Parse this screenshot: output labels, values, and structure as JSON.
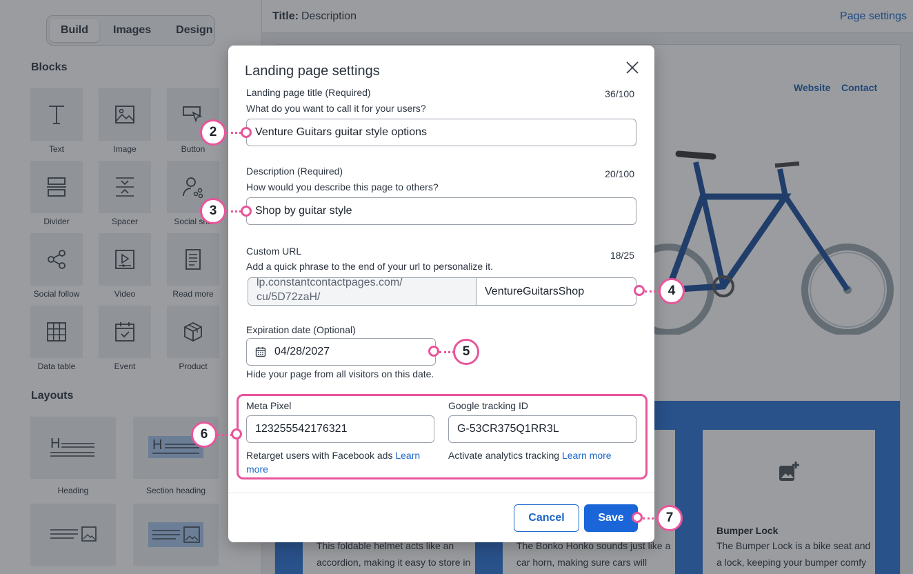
{
  "builder": {
    "tabs": [
      "Build",
      "Images",
      "Design"
    ],
    "active_tab": "Build",
    "blocks_title": "Blocks",
    "blocks": [
      {
        "label": "Text",
        "icon": "text-icon"
      },
      {
        "label": "Image",
        "icon": "image-icon"
      },
      {
        "label": "Button",
        "icon": "button-icon"
      },
      {
        "label": "Divider",
        "icon": "divider-icon"
      },
      {
        "label": "Spacer",
        "icon": "spacer-icon"
      },
      {
        "label": "Social sha",
        "icon": "social-share-icon"
      },
      {
        "label": "Social follow",
        "icon": "social-follow-icon"
      },
      {
        "label": "Video",
        "icon": "video-icon"
      },
      {
        "label": "Read more",
        "icon": "read-more-icon"
      },
      {
        "label": "Data table",
        "icon": "data-table-icon"
      },
      {
        "label": "Event",
        "icon": "event-icon"
      },
      {
        "label": "Product",
        "icon": "product-icon"
      }
    ],
    "layouts_title": "Layouts",
    "layouts": [
      {
        "label": "Heading",
        "icon": "heading-layout-icon"
      },
      {
        "label": "Section heading",
        "icon": "section-heading-layout-icon"
      }
    ]
  },
  "topbar": {
    "title_label": "Title:",
    "title_value": "Description",
    "page_settings": "Page settings"
  },
  "preview": {
    "nav": [
      "Website",
      "Contact"
    ],
    "cards": [
      {
        "title": "",
        "text": "This foldable helmet acts like an accordion, making it easy to store in"
      },
      {
        "title": "",
        "text": "The Bonko Honko sounds just like a car horn, making sure cars will"
      },
      {
        "title": "Bumper Lock",
        "text": "The Bumper Lock is a bike seat and a lock, keeping your bumper comfy"
      }
    ]
  },
  "modal": {
    "title": "Landing page settings",
    "page_title": {
      "label": "Landing page title",
      "required": "(Required)",
      "help": "What do you want to call it for your users?",
      "value": "Venture Guitars guitar style options",
      "counter": "36/100"
    },
    "description": {
      "label": "Description",
      "required": "(Required)",
      "help": "How would you describe this page to others?",
      "value": "Shop by guitar style",
      "counter": "20/100"
    },
    "custom_url": {
      "label": "Custom URL",
      "help": "Add a quick phrase to the end of your url to personalize it.",
      "prefix_line1": "lp.constantcontactpages.com/",
      "prefix_line2": "cu/5D72zaH/",
      "value": "VentureGuitarsShop",
      "counter": "18/25"
    },
    "expiration": {
      "label": "Expiration date",
      "optional": "(Optional)",
      "value": "04/28/2027",
      "help": "Hide your page from all visitors on this date."
    },
    "meta_pixel": {
      "label": "Meta Pixel",
      "value": "123255542176321",
      "help": "Retarget users with Facebook ads",
      "link_part1": "Learn",
      "link_part2": "more"
    },
    "google": {
      "label": "Google tracking ID",
      "value": "G-53CR375Q1RR3L",
      "help": "Activate analytics tracking",
      "link": "Learn more"
    },
    "cancel": "Cancel",
    "save": "Save"
  },
  "annotations": [
    "2",
    "3",
    "4",
    "5",
    "6",
    "7"
  ],
  "colors": {
    "accent": "#1a66d9",
    "link": "#1a66c9",
    "callout": "#e8559a",
    "overlay": "rgba(40,44,52,0.47)"
  }
}
